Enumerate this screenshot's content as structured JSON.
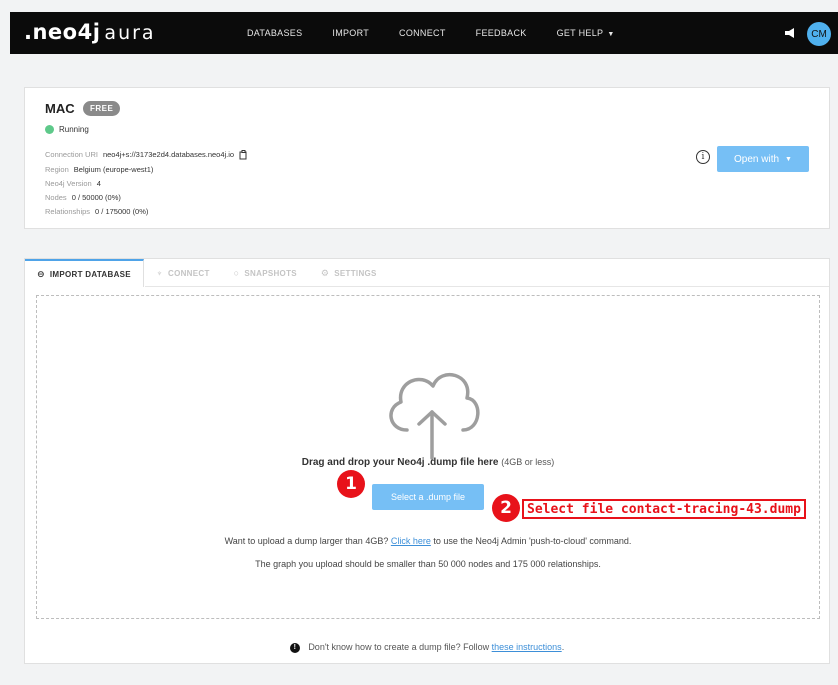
{
  "brand": {
    "neo": ".neo4j",
    "aura": "aura"
  },
  "nav": {
    "items": [
      "DATABASES",
      "IMPORT",
      "CONNECT",
      "FEEDBACK",
      "GET HELP"
    ],
    "get_help_caret": "▼"
  },
  "user": {
    "initials": "CM"
  },
  "database": {
    "name": "MAC",
    "tier_badge": "FREE",
    "status": "Running",
    "status_color": "#5ec98a",
    "meta": [
      {
        "key": "Connection URI",
        "value": "neo4j+s://3173e2d4.databases.neo4j.io"
      },
      {
        "key": "Region",
        "value": "Belgium (europe-west1)"
      },
      {
        "key": "Neo4j Version",
        "value": "4"
      },
      {
        "key": "Nodes",
        "value": "0 / 50000 (0%)"
      },
      {
        "key": "Relationships",
        "value": "0 / 175000 (0%)"
      }
    ],
    "open_with_label": "Open with"
  },
  "tabs": [
    {
      "label": "IMPORT DATABASE",
      "active": true
    },
    {
      "label": "CONNECT",
      "active": false
    },
    {
      "label": "SNAPSHOTS",
      "active": false
    },
    {
      "label": "SETTINGS",
      "active": false
    }
  ],
  "import": {
    "drag_bold": "Drag and drop your Neo4j .dump file here",
    "drag_small": "(4GB or less)",
    "select_button": "Select a .dump file",
    "upload_prefix": "Want to upload a dump larger than 4GB?",
    "upload_link": "Click here",
    "upload_suffix": "to use the Neo4j Admin 'push-to-cloud' command.",
    "limit_text": "The graph you upload should be smaller than 50 000 nodes and 175 000 relationships.",
    "howto_prefix": "Don't know how to create a dump file? Follow",
    "howto_link": "these instructions",
    "howto_suffix": "."
  },
  "annotations": {
    "step1": "1",
    "step2": "2",
    "callout": "Select file contact-tracing-43.dump",
    "color": "#e8121a"
  },
  "accent_color": "#76bff5"
}
